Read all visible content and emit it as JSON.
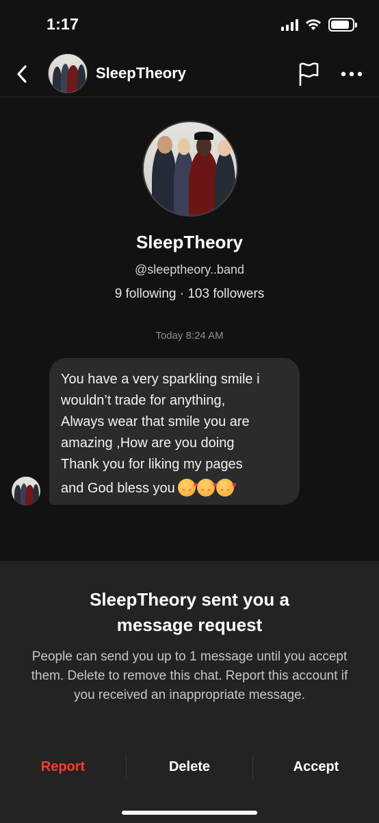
{
  "status_bar": {
    "time": "1:17",
    "battery_level": 0.85
  },
  "header": {
    "title": "SleepTheory",
    "back_icon": "chevron-left-icon",
    "flag_icon": "flag-icon",
    "more_icon": "more-horizontal-icon"
  },
  "profile": {
    "name": "SleepTheory",
    "handle": "@sleeptheory..band",
    "stats": "9 following · 103 followers"
  },
  "conversation": {
    "timestamp": "Today 8:24 AM",
    "message_lines": [
      "You have a very sparkling smile i",
      "wouldn’t trade for anything,",
      "Always wear that smile you are",
      "amazing ,How are you doing",
      "Thank you for liking my pages",
      "and God bless you"
    ],
    "emoji_count": 3,
    "emoji_name": "smiling-face-with-hearts"
  },
  "request": {
    "title_line1": "SleepTheory sent you a",
    "title_line2": "message request",
    "body": "People can send you up to 1 message until you accept them. Delete to remove this chat. Report this account if you received an inappropriate message.",
    "report_label": "Report",
    "delete_label": "Delete",
    "accept_label": "Accept"
  },
  "colors": {
    "background": "#121212",
    "bubble": "#2b2b2b",
    "panel": "#232323",
    "report": "#ff3b30"
  }
}
